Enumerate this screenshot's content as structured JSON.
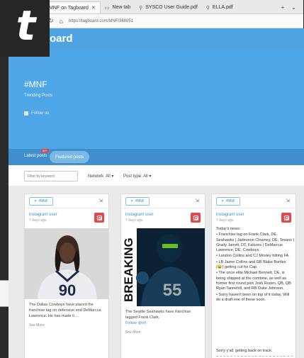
{
  "browser": {
    "tabs": [
      {
        "title": "MNF on Tagboard"
      },
      {
        "title": "New tab"
      },
      {
        "title": "SYSCO User Guide.pdf"
      },
      {
        "title": "ELLA.pdf"
      }
    ],
    "url": "https://tagboard.com/MNF/366051"
  },
  "site": {
    "logo_glyph": "t",
    "brand": "oard"
  },
  "hero": {
    "title": "#MNF",
    "subtitle": "Trending Posts",
    "follow": "Follow us"
  },
  "controls": {
    "latest": "Latest posts",
    "badge": "99+",
    "featured": "Featured posts",
    "search_placeholder": "Filter by keyword",
    "network": "Network: All ▾",
    "post_type": "Post type: All ▾"
  },
  "cards": [
    {
      "tag": "#MNF",
      "network": "Instagram",
      "author": "instagram user",
      "age": "7 days ago",
      "caption": "The Dallas Cowboys have placed the franchise tag on defensive end DeMarcus Lawrence. He has made it ...",
      "see_more": "See More",
      "jersey": "90"
    },
    {
      "tag": "#MNF",
      "network": "Instagram",
      "author": "instagram user",
      "age": "7 days ago",
      "breaking": "BREAKING",
      "jersey": "55",
      "caption": "The Seattle Seahawks have franchise tagged Frank Clark.",
      "follow": "Follow @nfl",
      "see_more": "See More"
    },
    {
      "tag": "#MNF",
      "network": "Instagram",
      "author": "instagram user",
      "age": "7 days ago",
      "lines": [
        "Today's news:",
        "• Franchise tag on Frank Clark, DE, Seahawks | Jadeveon Clowney, DE, Texans | Grady Jarrett, DT, Falcons | DeMarcus Lawrence, DE, Cowboys.",
        "• Landon Collins and CJ Mosley hitting FA.",
        "• LB Jaime Collins and GB Blake Bortles (😄) getting cut for Cap.",
        "• The once elite Michael Bennett, DE, is being shipped at the combine, as well as former first round pick Josh Rosen, QB, QB Ryan Tannehill, and RB Duke Johnson.",
        "• Sorry haven't been on top of it today. Will do a draft one of these soon."
      ],
      "footer": "Sorry y'all, getting back on track."
    }
  ],
  "colors": {
    "hero": "#4fa6e6",
    "accent": "#3d8fc6",
    "instagram": "#e5484d"
  }
}
